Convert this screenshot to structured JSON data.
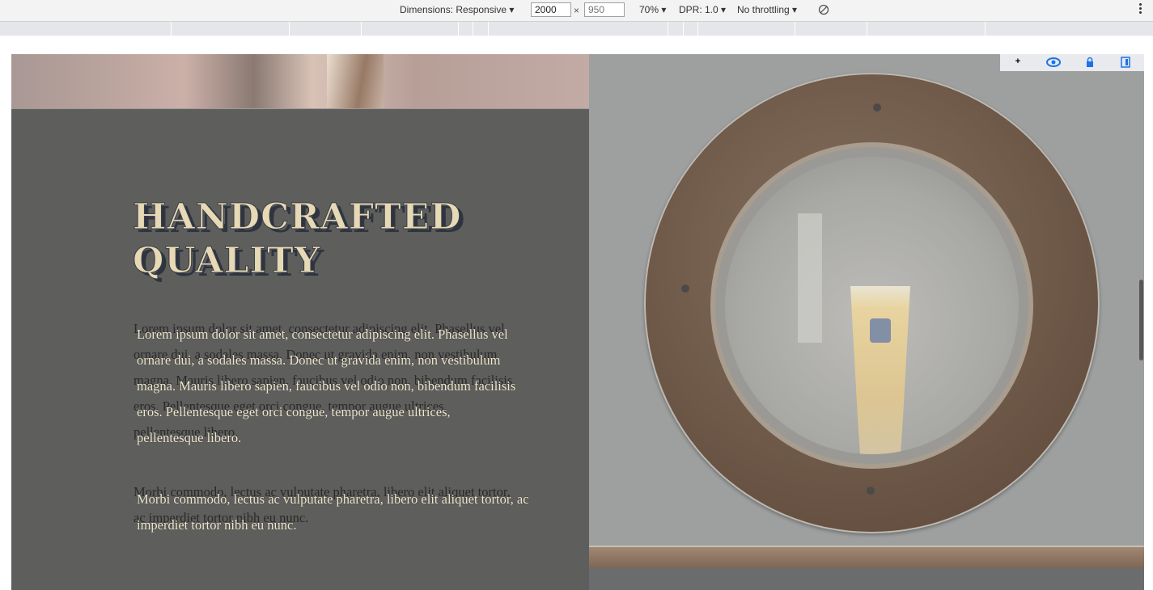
{
  "toolbar": {
    "dimensions_label": "Dimensions: Responsive ▾",
    "width_value": "2000",
    "times": "×",
    "height_placeholder": "950",
    "zoom": "70% ▾",
    "dpr": "DPR: 1.0 ▾",
    "throttling": "No throttling ▾"
  },
  "page": {
    "heading": "HANDCRAFTED QUALITY",
    "paragraph1": "Lorem ipsum dolor sit amet, consectetur adipiscing elit. Phasellus vel ornare dui, a sodales massa. Donec ut gravida enim, non vestibulum magna. Mauris libero sapien, faucibus vel odio non, bibendum facilisis eros. Pellentesque eget orci congue, tempor augue ultrices, pellentesque libero.",
    "paragraph2": "Morbi commodo, lectus ac vulputate pharetra, libero elit aliquet tortor, ac imperdiet tortor nibh eu nunc."
  },
  "viewport_icons": {
    "plus": "+",
    "eye": "visibility-icon",
    "lock": "lock-icon",
    "toggle": "panel-toggle-icon"
  },
  "colors": {
    "section_bg": "#5e5e5c",
    "heading_fill": "#e7d8b6",
    "heading_shadow": "#2e3540",
    "devtools_accent": "#1a73e8"
  }
}
